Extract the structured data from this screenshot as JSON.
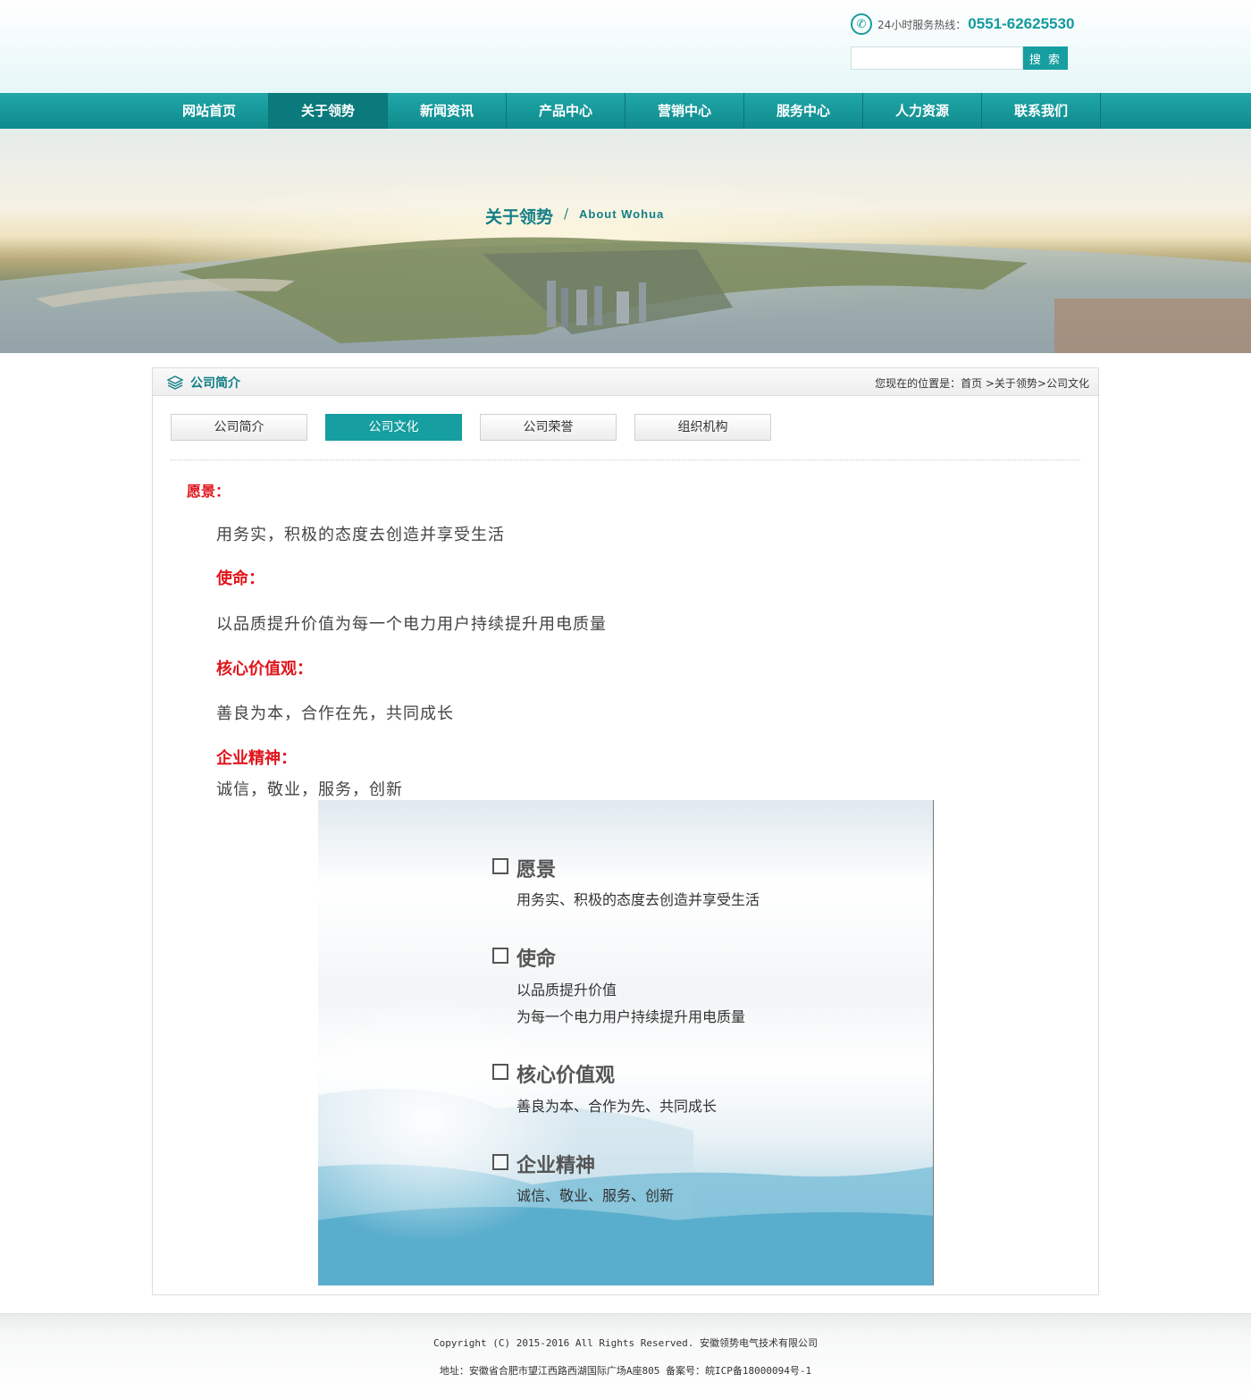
{
  "header": {
    "hotline_label": "24小时服务热线：",
    "hotline_number": "0551-62625530",
    "search_placeholder": "",
    "search_button": "搜 索"
  },
  "nav": {
    "items": [
      "网站首页",
      "关于领势",
      "新闻资讯",
      "产品中心",
      "营销中心",
      "服务中心",
      "人力资源",
      "联系我们"
    ],
    "active_index": 1
  },
  "banner": {
    "title": "关于领势",
    "separator": "/",
    "subtitle": "About Wohua"
  },
  "content": {
    "section_title": "公司简介",
    "breadcrumb": "您现在的位置是：首页 >关于领势>公司文化",
    "tabs": [
      "公司简介",
      "公司文化",
      "公司荣誉",
      "组织机构"
    ],
    "active_tab": 1,
    "blocks": {
      "vision_title": "愿景：",
      "vision_text": "用务实，积极的态度去创造并享受生活",
      "mission_title": "使命：",
      "mission_text": "以品质提升价值为每一个电力用户持续提升用电质量",
      "values_title": "核心价值观：",
      "values_text": "善良为本，合作在先，共同成长",
      "spirit_title": "企业精神：",
      "spirit_text": "诚信，敬业，服务，创新"
    },
    "image": {
      "vision_head": "愿景",
      "vision_line": "用务实、积极的态度去创造并享受生活",
      "mission_head": "使命",
      "mission_line1": "以品质提升价值",
      "mission_line2": "为每一个电力用户持续提升用电质量",
      "values_head": "核心价值观",
      "values_line": "善良为本、合作为先、共同成长",
      "spirit_head": "企业精神",
      "spirit_line": "诚信、敬业、服务、创新"
    }
  },
  "footer": {
    "copyright": "Copyright (C) 2015-2016 All Rights Reserved. 安徽领势电气技术有限公司",
    "address": "地址：安徽省合肥市望江西路西湖国际广场A座805   备案号：皖ICP备18000094号-1"
  },
  "colors": {
    "accent": "#169ea0",
    "heading_red": "#e0141c",
    "nav_bg": "#1a9a9c"
  }
}
